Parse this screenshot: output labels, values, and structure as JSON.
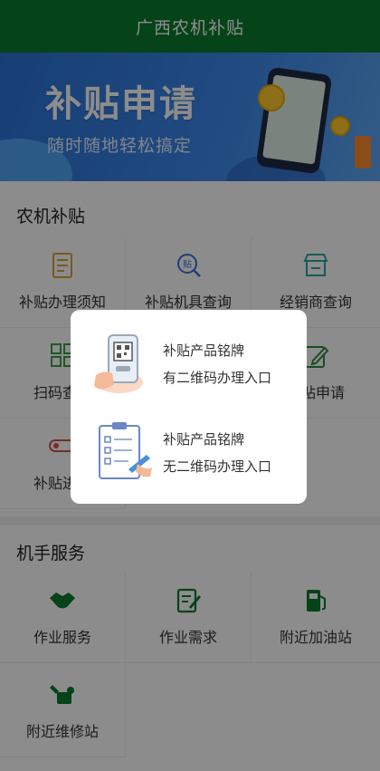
{
  "app_title": "广西农机补贴",
  "banner": {
    "title": "补贴申请",
    "subtitle": "随时随地轻松搞定"
  },
  "sections": {
    "farm_subsidy": {
      "title": "农机补贴",
      "items": [
        {
          "label": "补贴办理须知",
          "icon": "document-list-icon",
          "color": "#d9a23a"
        },
        {
          "label": "补贴机具查询",
          "icon": "search-subsidy-icon",
          "color": "#3b6fd6"
        },
        {
          "label": "经销商查询",
          "icon": "store-icon",
          "color": "#2aa6a0"
        },
        {
          "label": "扫码查询",
          "icon": "qr-grid-icon",
          "color": "#3aa14a"
        },
        {
          "label": "",
          "icon": "",
          "color": ""
        },
        {
          "label": "补贴申请",
          "icon": "edit-icon",
          "color": "#2d8a3c"
        },
        {
          "label": "补贴进度",
          "icon": "progress-icon",
          "color": "#d9534f"
        }
      ]
    },
    "operator_service": {
      "title": "机手服务",
      "items": [
        {
          "label": "作业服务",
          "icon": "handshake-icon",
          "color": "#0a7a2f"
        },
        {
          "label": "作业需求",
          "icon": "edit-note-icon",
          "color": "#0a7a2f"
        },
        {
          "label": "附近加油站",
          "icon": "gas-station-icon",
          "color": "#0a7a2f"
        },
        {
          "label": "附近维修站",
          "icon": "repair-icon",
          "color": "#0a7a2f"
        }
      ]
    }
  },
  "dialog": {
    "options": [
      {
        "line1": "补贴产品铭牌",
        "line2": "有二维码办理入口",
        "icon": "qr-phone-icon"
      },
      {
        "line1": "补贴产品铭牌",
        "line2": "无二维码办理入口",
        "icon": "checklist-icon"
      }
    ]
  }
}
